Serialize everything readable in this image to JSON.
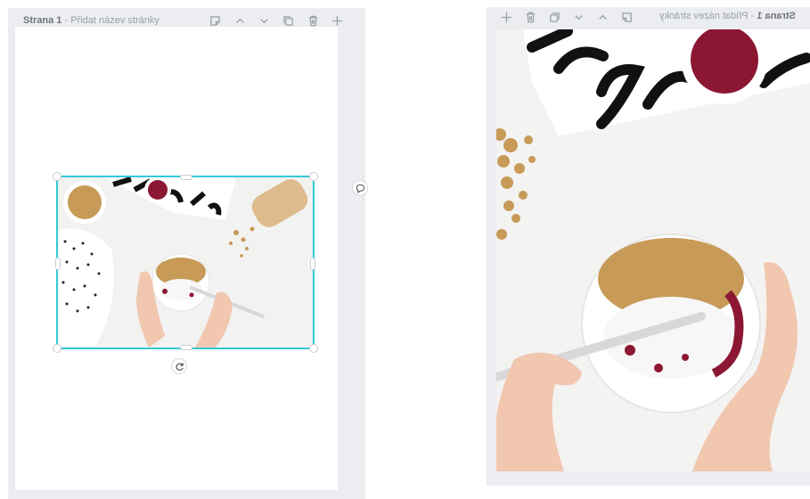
{
  "left_page": {
    "page_number_label": "Strana 1",
    "separator": " - ",
    "page_title_placeholder": "Přidat název stránky"
  },
  "right_page": {
    "page_number_label": "Strana 1",
    "separator": " - ",
    "page_title_placeholder": "Přidat název stránky"
  },
  "toolbar_icons": [
    "note-icon",
    "chevron-up-icon",
    "chevron-down-icon",
    "duplicate-icon",
    "trash-icon",
    "plus-icon"
  ],
  "colors": {
    "selection": "#35c9d4",
    "panel_bg": "#ebedf0",
    "page_bg": "#ffffff"
  }
}
